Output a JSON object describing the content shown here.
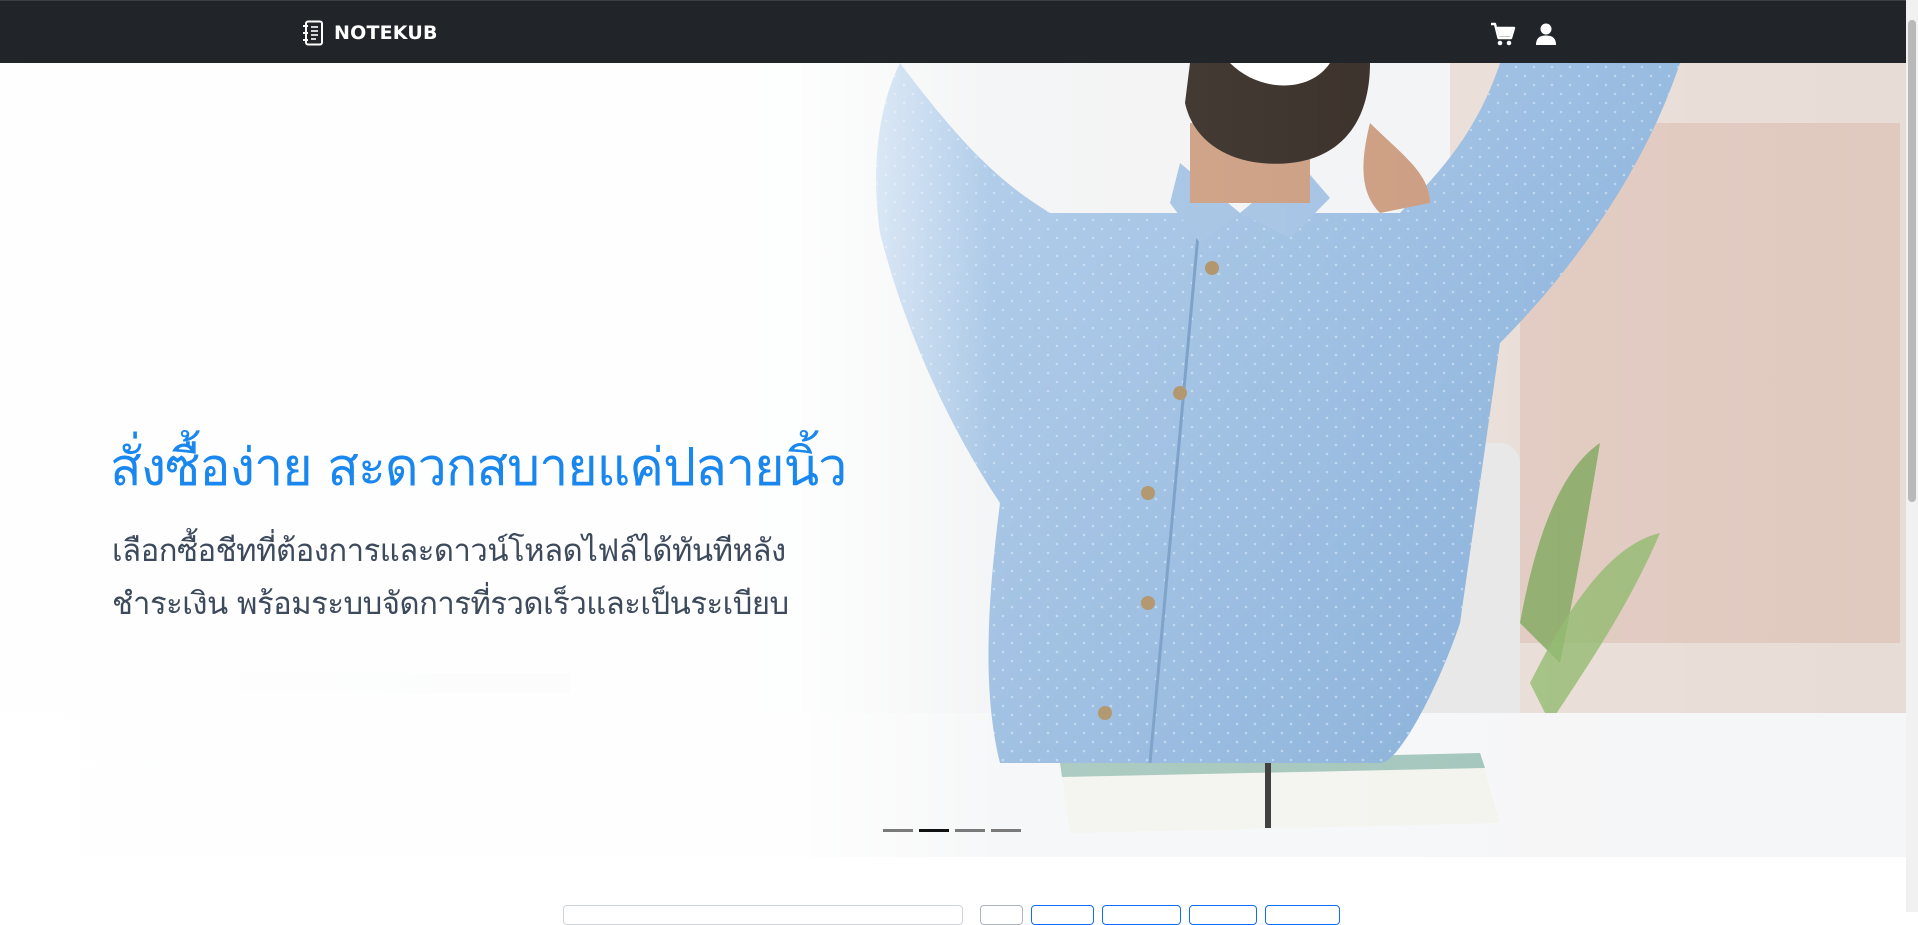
{
  "navbar": {
    "brand": "NOTEKUB",
    "brand_icon": "notebook-icon",
    "cart_icon": "cart-icon",
    "user_icon": "user-icon",
    "background": "#212529"
  },
  "hero": {
    "title": "สั่งซื้อง่าย สะดวกสบายแค่ปลายนิ้ว",
    "subtitle_line1": "เลือกซื้อชีทที่ต้องการและดาวน์โหลดไฟล์ได้ทันทีหลัง",
    "subtitle_line2": "ชำระเงิน พร้อมระบบจัดการที่รวดเร็วและเป็นระเบียบ",
    "title_color": "#1a87ee",
    "subtitle_color": "#3d4a5c",
    "slide_count": 4,
    "active_slide": 2
  },
  "toolbar": {
    "accent": "#0d6efd"
  }
}
